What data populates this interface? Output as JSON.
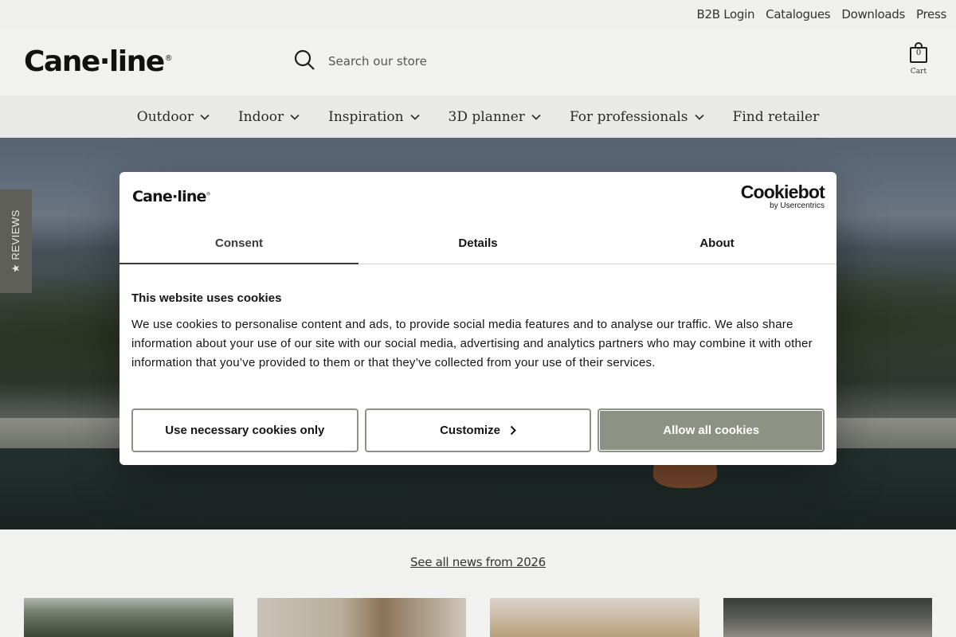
{
  "topbar": {
    "links": [
      "B2B Login",
      "Catalogues",
      "Downloads",
      "Press"
    ]
  },
  "header": {
    "logo_text": "Cane·line",
    "logo_mark": "®",
    "search_placeholder": "Search our store",
    "cart_count": "0",
    "cart_label": "Cart"
  },
  "nav": {
    "items": [
      {
        "label": "Outdoor",
        "has_dropdown": true
      },
      {
        "label": "Indoor",
        "has_dropdown": true
      },
      {
        "label": "Inspiration",
        "has_dropdown": true
      },
      {
        "label": "3D planner",
        "has_dropdown": true
      },
      {
        "label": "For professionals",
        "has_dropdown": true
      },
      {
        "label": "Find retailer",
        "has_dropdown": false
      }
    ]
  },
  "reviews_tab": {
    "label": "★ REVIEWS"
  },
  "cookie_dialog": {
    "logo_text": "Cane·line",
    "logo_mark": "®",
    "provider_name": "Cookiebot",
    "provider_sub": "by Usercentrics",
    "tabs": [
      {
        "label": "Consent",
        "active": true
      },
      {
        "label": "Details",
        "active": false
      },
      {
        "label": "About",
        "active": false
      }
    ],
    "title": "This website uses cookies",
    "text": "We use cookies to personalise content and ads, to provide social media features and to analyse our traffic. We also share information about your use of our site with our social media, advertising and analytics partners who may combine it with other information that you’ve provided to them or that they’ve collected from your use of their services.",
    "buttons": {
      "necessary": "Use necessary cookies only",
      "customize": "Customize",
      "allow_all": "Allow all cookies"
    }
  },
  "news": {
    "link_text": "See all news from 2026"
  },
  "colors": {
    "accent_button": "#8c9385",
    "page_bg": "#f1f1ef",
    "nav_bg": "#e9e9e6",
    "reviews_tab_bg": "#5f5f59"
  }
}
